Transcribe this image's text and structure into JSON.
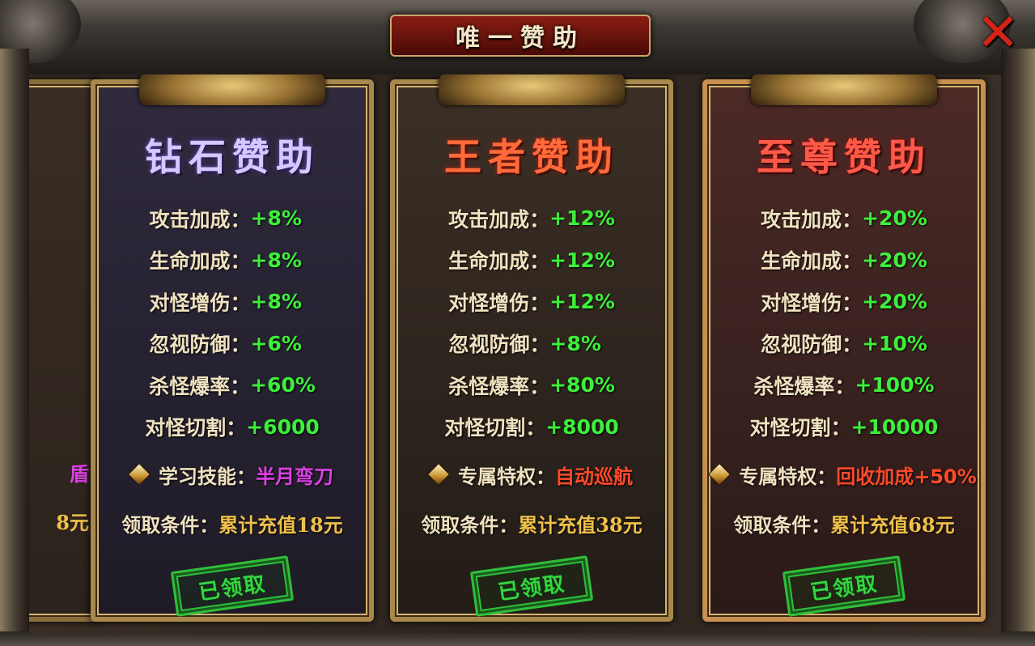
{
  "dialog": {
    "title": "唯一赞助",
    "close_glyph": "✕"
  },
  "partial_card": {
    "perk_fragment": "盾",
    "condition_fragment": "8元"
  },
  "cards": [
    {
      "id": "diamond",
      "title": "钻石赞助",
      "stats": [
        {
          "label": "攻击加成：",
          "value": "+8%"
        },
        {
          "label": "生命加成：",
          "value": "+8%"
        },
        {
          "label": "对怪增伤：",
          "value": "+8%"
        },
        {
          "label": "忽视防御：",
          "value": "+6%"
        },
        {
          "label": "杀怪爆率：",
          "value": "+60%"
        },
        {
          "label": "对怪切割：",
          "value": "+6000"
        }
      ],
      "perk_label": "学习技能：",
      "perk_value": "半月弯刀",
      "condition_label": "领取条件：",
      "condition_value": "累计充值18元",
      "status": "已领取",
      "title_color": "#d6c8ff"
    },
    {
      "id": "king",
      "title": "王者赞助",
      "stats": [
        {
          "label": "攻击加成：",
          "value": "+12%"
        },
        {
          "label": "生命加成：",
          "value": "+12%"
        },
        {
          "label": "对怪增伤：",
          "value": "+12%"
        },
        {
          "label": "忽视防御：",
          "value": "+8%"
        },
        {
          "label": "杀怪爆率：",
          "value": "+80%"
        },
        {
          "label": "对怪切割：",
          "value": "+8000"
        }
      ],
      "perk_label": "专属特权：",
      "perk_value": "自动巡航",
      "condition_label": "领取条件：",
      "condition_value": "累计充值38元",
      "status": "已领取",
      "title_color": "#ff6a3a"
    },
    {
      "id": "supreme",
      "title": "至尊赞助",
      "stats": [
        {
          "label": "攻击加成：",
          "value": "+20%"
        },
        {
          "label": "生命加成：",
          "value": "+20%"
        },
        {
          "label": "对怪增伤：",
          "value": "+20%"
        },
        {
          "label": "忽视防御：",
          "value": "+10%"
        },
        {
          "label": "杀怪爆率：",
          "value": "+100%"
        },
        {
          "label": "对怪切割：",
          "value": "+10000"
        }
      ],
      "perk_label": "专属特权：",
      "perk_value": "回收加成+50%",
      "condition_label": "领取条件：",
      "condition_value": "累计充值68元",
      "status": "已领取",
      "title_color": "#ff5a48"
    }
  ],
  "colors": {
    "stat_value": "#3cf03a",
    "label": "#f0e2c0",
    "condition_value": "#f0c04a",
    "stamp": "#2ec03a",
    "close": "#d42418"
  },
  "icons": {
    "perk_bullet": "diamond-gem-icon",
    "close": "close-icon"
  }
}
